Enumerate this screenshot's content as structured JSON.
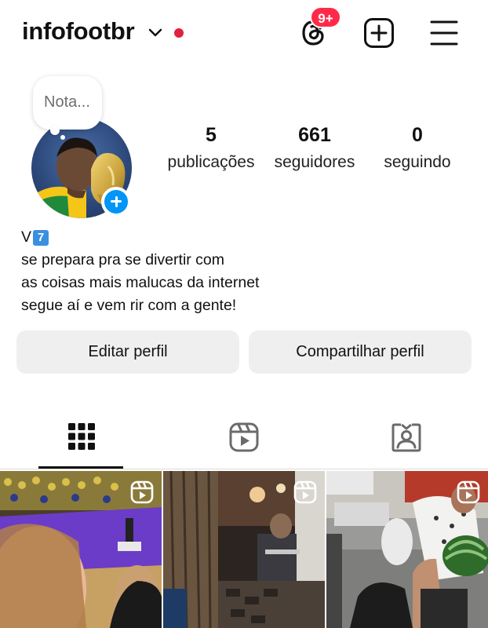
{
  "header": {
    "username": "infofootbr",
    "notification_badge": "9+",
    "accent_colors": {
      "badge": "#ff2a48",
      "dot": "#e0213f",
      "add_story": "#0095f6"
    }
  },
  "note": {
    "placeholder": "Nota..."
  },
  "stats": [
    {
      "value": "5",
      "label": "publicações"
    },
    {
      "value": "661",
      "label": "seguidores"
    },
    {
      "value": "0",
      "label": "seguindo"
    }
  ],
  "bio": {
    "name": "V",
    "name_emoji": "7",
    "lines": [
      "se prepara pra se divertir com",
      "as coisas mais malucas da internet",
      "segue aí e vem rir com a gente!"
    ]
  },
  "buttons": {
    "edit": "Editar perfil",
    "share": "Compartilhar perfil"
  },
  "tabs": [
    {
      "icon": "grid-icon",
      "selected": true
    },
    {
      "icon": "reels-icon",
      "selected": false
    },
    {
      "icon": "tagged-icon",
      "selected": false
    }
  ],
  "posts": [
    {
      "type": "reel",
      "icon": "reel-icon"
    },
    {
      "type": "reel",
      "icon": "reel-icon"
    },
    {
      "type": "reel",
      "icon": "reel-icon"
    }
  ]
}
